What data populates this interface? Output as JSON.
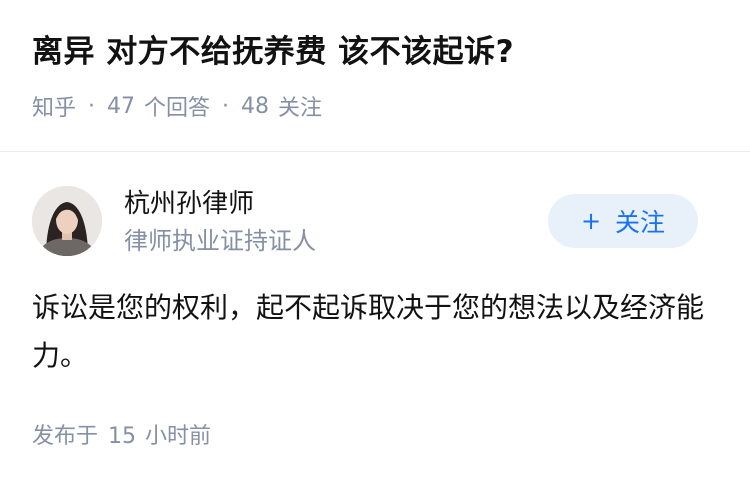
{
  "question": {
    "title": "离异 对方不给抚养费 该不该起诉?",
    "source": "知乎",
    "answers_count": "47",
    "answers_label": "个回答",
    "followers_count": "48",
    "followers_label": "关注"
  },
  "answer": {
    "author_name": "杭州孙律师",
    "author_badge": "律师执业证持证人",
    "follow_icon": "plus-icon",
    "follow_label": "关注",
    "content": "诉讼是您的权利，起不起诉取决于您的想法以及经济能力。",
    "publish_prefix": "发布于",
    "publish_number": "15",
    "publish_suffix": "小时前"
  },
  "colors": {
    "text": "#121212",
    "meta": "#8590a6",
    "brand_blue": "#1772f6",
    "button_bg": "#e8f1fa",
    "divider": "#ebebeb"
  }
}
